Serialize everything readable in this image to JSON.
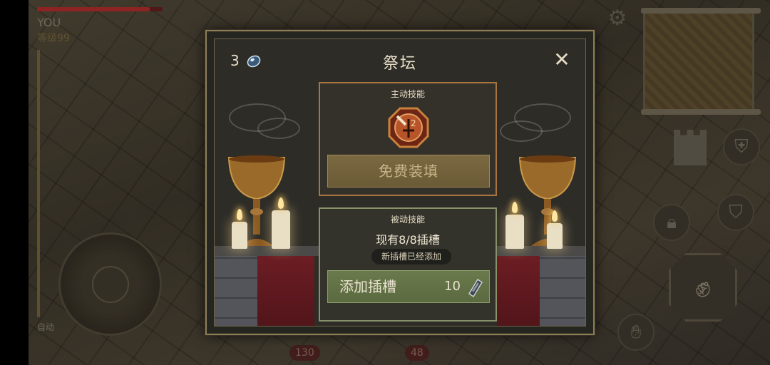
{
  "hud": {
    "player_name": "YOU",
    "player_level": "等级99",
    "hp_fraction": 0.9,
    "auto_label": "自动",
    "badge_left": "130",
    "badge_right": "48"
  },
  "dialog": {
    "title": "祭坛",
    "gem_count": "3",
    "close_icon": "close-icon"
  },
  "active_skill": {
    "label": "主动技能",
    "button_label": "免费装填"
  },
  "passive_skill": {
    "label": "被动技能",
    "slot_status": "现有8/8插槽",
    "tip": "新插槽已经添加",
    "button_label": "添加插槽",
    "cost": "10"
  },
  "colors": {
    "active_border": "#a87542",
    "passive_border": "#87926b",
    "frame_gold": "#8e7d55"
  }
}
